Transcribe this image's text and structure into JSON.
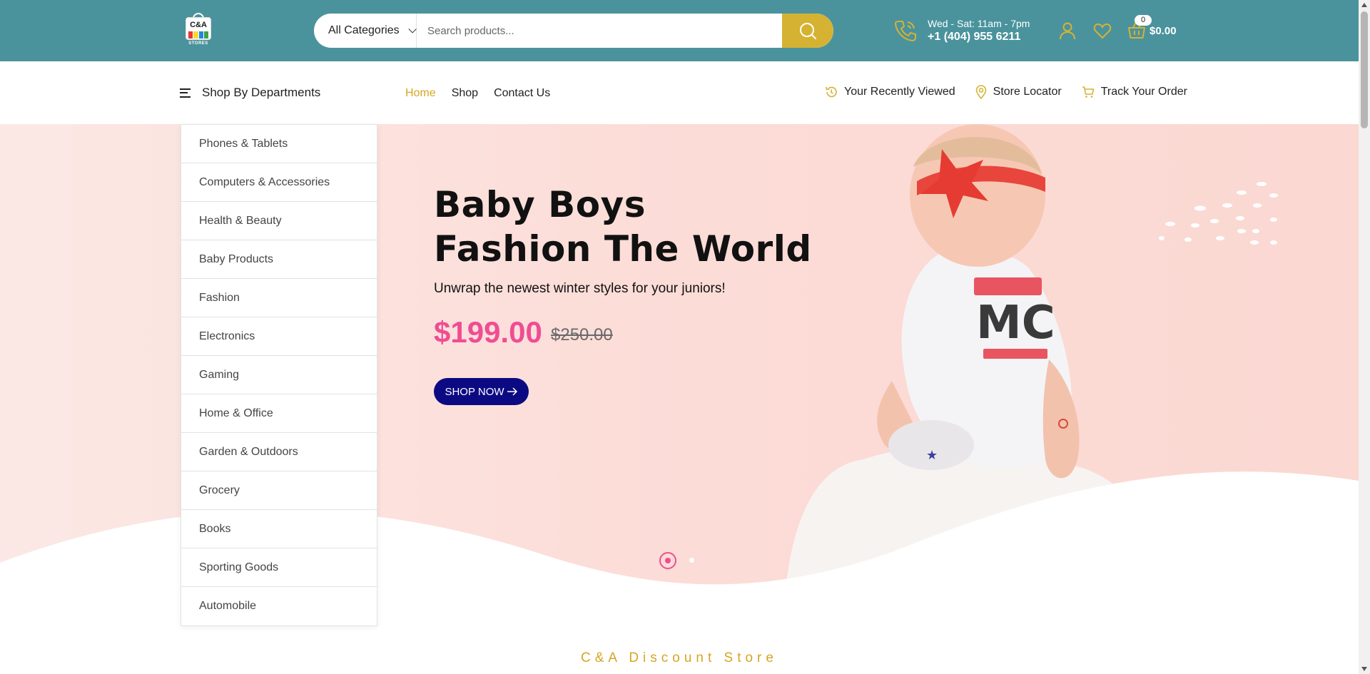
{
  "header": {
    "logo_text": "C&A",
    "logo_subtext": "STORES",
    "category_select": "All Categories",
    "search_placeholder": "Search products...",
    "hours": "Wed - Sat: 11am - 7pm",
    "phone": "+1 (404) 955 6211",
    "cart_count": "0",
    "cart_total": "$0.00"
  },
  "nav": {
    "departments_label": "Shop By Departments",
    "links": [
      "Home",
      "Shop",
      "Contact Us"
    ],
    "active": "Home",
    "right": [
      "Your Recently Viewed",
      "Store Locator",
      "Track Your Order"
    ]
  },
  "departments": [
    "Phones & Tablets",
    "Computers & Accessories",
    "Health & Beauty",
    "Baby Products",
    "Fashion",
    "Electronics",
    "Gaming",
    "Home & Office",
    "Garden & Outdoors",
    "Grocery",
    "Books",
    "Sporting Goods",
    "Automobile"
  ],
  "hero": {
    "title_line1": "Baby Boys",
    "title_line2": "Fashion The World",
    "subtitle": "Unwrap the newest winter styles for your juniors!",
    "price": "$199.00",
    "old_price": "$250.00",
    "cta": "SHOP NOW",
    "slide_count": 2,
    "active_slide": 1
  },
  "section_tag": "C&A Discount Store",
  "colors": {
    "header_bg": "#4a939d",
    "accent_gold": "#d6b233",
    "price_pink": "#ef4d93",
    "cta_navy": "#0c0a83"
  }
}
